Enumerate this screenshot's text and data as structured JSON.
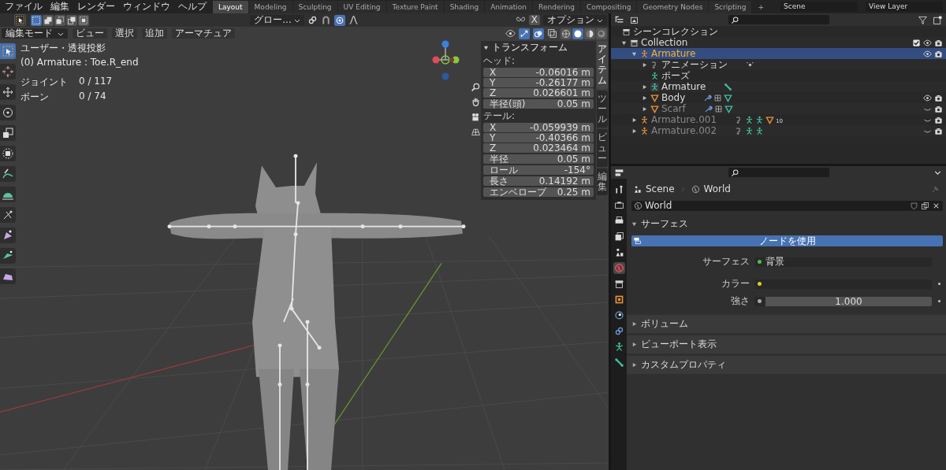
{
  "menu": [
    "ファイル",
    "編集",
    "レンダー",
    "ウィンドウ",
    "ヘルプ"
  ],
  "workspaces": [
    {
      "label": "Layout",
      "selected": true
    },
    {
      "label": "Modeling",
      "selected": false
    },
    {
      "label": "Sculpting",
      "selected": false
    },
    {
      "label": "UV Editing",
      "selected": false
    },
    {
      "label": "Texture Paint",
      "selected": false
    },
    {
      "label": "Shading",
      "selected": false
    },
    {
      "label": "Animation",
      "selected": false
    },
    {
      "label": "Rendering",
      "selected": false
    },
    {
      "label": "Compositing",
      "selected": false
    },
    {
      "label": "Geometry Nodes",
      "selected": false
    },
    {
      "label": "Scripting",
      "selected": false
    }
  ],
  "add_workspace": "+",
  "scene": "Scene",
  "view_layer": "View Layer",
  "viewport": {
    "select_modes": [
      {
        "kind": "set",
        "selected": true
      },
      {
        "kind": "extend",
        "selected": false
      },
      {
        "kind": "subtract",
        "selected": false
      },
      {
        "kind": "difference",
        "selected": false
      },
      {
        "kind": "intersect",
        "selected": false
      }
    ],
    "transform_orientation": "グロー...",
    "mirror": "X",
    "options": "オプション",
    "mode": "編集モード",
    "menus": [
      "ビュー",
      "選択",
      "追加",
      "アーマチュア"
    ],
    "shading": [
      {
        "kind": "wireframe",
        "selected": false
      },
      {
        "kind": "solid",
        "selected": true
      },
      {
        "kind": "material",
        "selected": false
      },
      {
        "kind": "rendered",
        "selected": false
      }
    ],
    "tools": [
      {
        "kind": "select",
        "selected": true
      },
      {
        "kind": "cursor",
        "selected": false
      },
      {
        "kind": "move",
        "selected": false
      },
      {
        "kind": "rotate",
        "selected": false
      },
      {
        "kind": "scale",
        "selected": false
      },
      {
        "kind": "transform",
        "selected": false
      },
      {
        "kind": "annotate",
        "selected": false
      },
      {
        "kind": "measure",
        "selected": false
      },
      {
        "kind": "roll",
        "selected": false
      },
      {
        "kind": "bone-size",
        "selected": false
      },
      {
        "kind": "extrude",
        "selected": false
      },
      {
        "kind": "envelope",
        "selected": false
      }
    ],
    "view_name": "ユーザー・透視投影",
    "active_item": "(0) Armature : Toe.R_end",
    "stats": [
      {
        "label": "ジョイント",
        "value": "0 / 117"
      },
      {
        "label": "ボーン",
        "value": "0 / 74"
      }
    ],
    "sidebar_tabs": [
      {
        "label": "アイテム",
        "selected": true
      },
      {
        "label": "ツール",
        "selected": false
      },
      {
        "label": "ビュー",
        "selected": false
      },
      {
        "label": "編集",
        "selected": false
      }
    ],
    "transform": {
      "title": "トランスフォーム",
      "blocks": [
        {
          "heading": "ヘッド:",
          "fields": [
            {
              "label": "X",
              "value": "-0.06016 m"
            },
            {
              "label": "Y",
              "value": "-0.26177 m"
            },
            {
              "label": "Z",
              "value": "0.026601 m"
            }
          ]
        },
        {
          "fields": [
            {
              "label": "半径(頭)",
              "value": "0.05 m"
            }
          ]
        },
        {
          "heading": "テール:",
          "fields": [
            {
              "label": "X",
              "value": "-0.059939 m"
            },
            {
              "label": "Y",
              "value": "-0.40366 m"
            },
            {
              "label": "Z",
              "value": "0.023464 m"
            }
          ]
        },
        {
          "fields": [
            {
              "label": "半径",
              "value": "0.05 m"
            }
          ]
        },
        {
          "fields": [
            {
              "label": "ロール",
              "value": "-154°"
            }
          ]
        },
        {
          "fields": [
            {
              "label": "長さ",
              "value": "0.14192 m"
            }
          ]
        },
        {
          "fields": [
            {
              "label": "エンベロープ",
              "value": "0.25 m"
            }
          ]
        }
      ]
    }
  },
  "outliner": {
    "root": "シーンコレクション",
    "items": [
      {
        "name": "Collection",
        "kind": "collection",
        "expanded": true,
        "checked": true,
        "visible": true,
        "selected": false,
        "children": [
          {
            "name": "Armature",
            "kind": "armature",
            "expanded": true,
            "visible": true,
            "selected": true,
            "children": [
              {
                "name": "アニメーション",
                "kind": "animation",
                "expanded": false,
                "selected": false,
                "extras": [
                  {
                    "kind": "keyframe"
                  }
                ]
              },
              {
                "name": "ポーズ",
                "kind": "pose",
                "selected": false
              },
              {
                "name": "Armature",
                "kind": "armature-data",
                "expanded": false,
                "selected": false,
                "extras": [
                  {
                    "kind": "bone"
                  }
                ]
              },
              {
                "name": "Body",
                "kind": "mesh",
                "expanded": false,
                "visible": true,
                "selected": false,
                "extras": [
                  {
                    "kind": "wrench"
                  },
                  {
                    "kind": "vertex-groups"
                  },
                  {
                    "kind": "mesh-data"
                  }
                ]
              },
              {
                "name": "Scarf",
                "kind": "mesh",
                "expanded": false,
                "visible": false,
                "selected": false,
                "extras": [
                  {
                    "kind": "wrench"
                  },
                  {
                    "kind": "vertex-groups"
                  },
                  {
                    "kind": "mesh-data"
                  }
                ]
              }
            ]
          },
          {
            "name": "Armature.001",
            "kind": "armature",
            "expanded": false,
            "visible": false,
            "selected": false,
            "extras": [
              {
                "kind": "action"
              },
              {
                "kind": "pose"
              },
              {
                "kind": "armature-data"
              },
              {
                "kind": "mesh"
              }
            ],
            "extra_count": "10"
          },
          {
            "name": "Armature.002",
            "kind": "armature",
            "expanded": false,
            "visible": false,
            "selected": false,
            "extras": [
              {
                "kind": "action"
              },
              {
                "kind": "pose"
              },
              {
                "kind": "armature-data"
              }
            ]
          }
        ]
      }
    ]
  },
  "properties": {
    "tabs": [
      {
        "kind": "tool",
        "selected": false
      },
      {
        "kind": "render",
        "selected": false
      },
      {
        "kind": "output",
        "selected": false
      },
      {
        "kind": "view-layer",
        "selected": false
      },
      {
        "kind": "scene",
        "selected": false
      },
      {
        "kind": "world",
        "selected": true
      },
      {
        "kind": "collection",
        "selected": false
      },
      {
        "kind": "object",
        "selected": false
      },
      {
        "kind": "physics",
        "selected": false
      },
      {
        "kind": "constraints",
        "selected": false
      },
      {
        "kind": "armature-data",
        "selected": false
      },
      {
        "kind": "bone",
        "selected": false
      }
    ],
    "breadcrumb": [
      "Scene",
      "World"
    ],
    "world": "World",
    "sections": [
      {
        "title": "サーフェス",
        "expanded": true,
        "button": "ノードを使用",
        "rows": [
          {
            "kind": "link",
            "label": "サーフェス",
            "color": "#4cc04c",
            "value": "背景"
          },
          {
            "kind": "color",
            "label": "カラー",
            "color": "#d8d21c"
          },
          {
            "kind": "number",
            "label": "強さ",
            "color": "#a8a8a8",
            "value": "1.000"
          }
        ]
      },
      {
        "title": "ボリューム",
        "expanded": false
      },
      {
        "title": "ビューポート表示",
        "expanded": false
      },
      {
        "title": "カスタムプロパティ",
        "expanded": false
      }
    ]
  }
}
